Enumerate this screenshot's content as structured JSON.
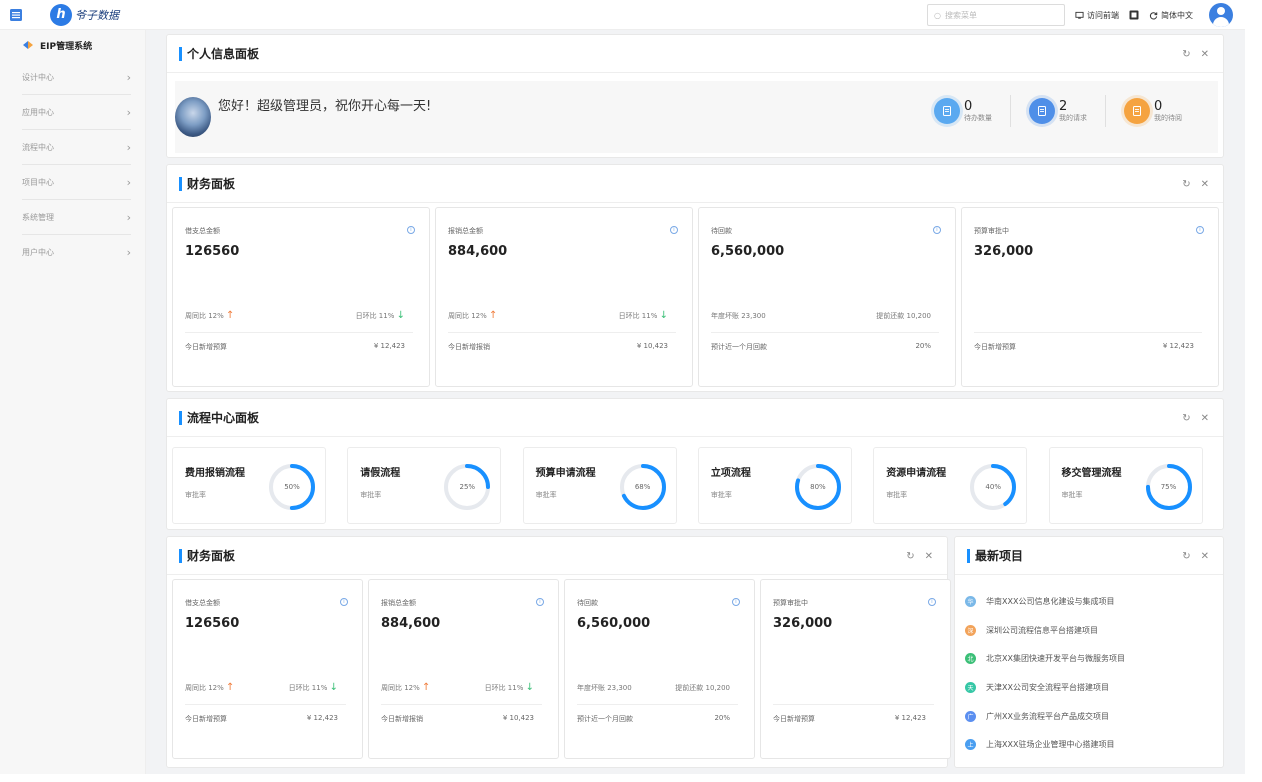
{
  "header": {
    "logo_mark": "h",
    "logo_text": "爷子数据",
    "search_placeholder": "搜索菜单",
    "visit_front": "访问前端",
    "language": "简体中文"
  },
  "sidebar": {
    "title": "EIP管理系统",
    "items": [
      {
        "label": "设计中心"
      },
      {
        "label": "应用中心"
      },
      {
        "label": "流程中心"
      },
      {
        "label": "项目中心"
      },
      {
        "label": "系统管理"
      },
      {
        "label": "用户中心"
      }
    ]
  },
  "personal_panel": {
    "title": "个人信息面板",
    "greeting": "您好！超级管理员，祝你开心每一天!",
    "stats": [
      {
        "value": "0",
        "label": "待办数量",
        "color": "#5aa9f0",
        "icon": "todo-icon"
      },
      {
        "value": "2",
        "label": "我的请求",
        "color": "#4f8fe8",
        "icon": "request-icon"
      },
      {
        "value": "0",
        "label": "我的待阅",
        "color": "#f5a340",
        "icon": "mail-icon"
      }
    ]
  },
  "finance_panel": {
    "title": "财务面板",
    "cards": [
      {
        "label": "借支总金额",
        "value": "126560",
        "left": "周同比 12%",
        "left_arrow": "↑",
        "right": "日环比 11%",
        "right_arrow": "↓",
        "foot_label": "今日新增预算",
        "foot_value": "¥ 12,423"
      },
      {
        "label": "报销总金额",
        "value": "884,600",
        "left": "周同比 12%",
        "left_arrow": "↑",
        "right": "日环比 11%",
        "right_arrow": "↓",
        "foot_label": "今日新增报销",
        "foot_value": "¥ 10,423"
      },
      {
        "label": "待回款",
        "value": "6,560,000",
        "left": "年度坏账 23,300",
        "left_arrow": "",
        "right": "提前还款 10,200",
        "right_arrow": "",
        "foot_label": "预计近一个月回款",
        "foot_value": "20%"
      },
      {
        "label": "预算审批中",
        "value": "326,000",
        "left": "",
        "left_arrow": "",
        "right": "",
        "right_arrow": "",
        "foot_label": "今日新增预算",
        "foot_value": "¥ 12,423"
      }
    ]
  },
  "process_panel": {
    "title": "流程中心面板",
    "sub_label": "审批率",
    "items": [
      {
        "name": "费用报销流程",
        "percent": 50,
        "text": "50%"
      },
      {
        "name": "请假流程",
        "percent": 25,
        "text": "25%"
      },
      {
        "name": "预算申请流程",
        "percent": 68,
        "text": "68%"
      },
      {
        "name": "立项流程",
        "percent": 80,
        "text": "80%"
      },
      {
        "name": "资源申请流程",
        "percent": 40,
        "text": "40%"
      },
      {
        "name": "移交管理流程",
        "percent": 75,
        "text": "75%"
      }
    ]
  },
  "finance_panel_2": {
    "title": "财务面板"
  },
  "latest_projects": {
    "title": "最新项目",
    "items": [
      {
        "label": "华南XXX公司信息化建设与集成项目",
        "color": "#7ab8e8",
        "glyph": "华"
      },
      {
        "label": "深圳公司流程信息平台搭建项目",
        "color": "#f2a35a",
        "glyph": "深"
      },
      {
        "label": "北京XX集团快速开发平台与微服务项目",
        "color": "#3bbf77",
        "glyph": "北"
      },
      {
        "label": "天津XX公司安全流程平台搭建项目",
        "color": "#36c7a6",
        "glyph": "天"
      },
      {
        "label": "广州XX业务流程平台产品成交项目",
        "color": "#5b8ff0",
        "glyph": "广"
      },
      {
        "label": "上海XXX驻场企业管理中心搭建项目",
        "color": "#4a9ef0",
        "glyph": "上"
      }
    ]
  },
  "colors": {
    "accent": "#1890ff",
    "ring_track": "#e6e9ee",
    "ring_fill": "#1890ff"
  }
}
